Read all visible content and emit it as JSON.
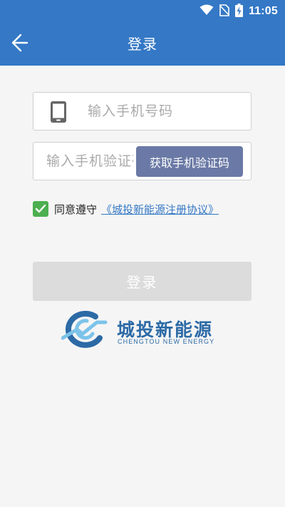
{
  "status_bar": {
    "time": "11:05",
    "icons": [
      "wifi-icon",
      "no-sim-icon",
      "battery-charging-icon"
    ]
  },
  "header": {
    "title": "登录",
    "back_icon": "back-arrow-icon"
  },
  "form": {
    "phone": {
      "icon": "mobile-phone-icon",
      "placeholder": "输入手机号码",
      "value": ""
    },
    "code": {
      "placeholder": "输入手机验证码",
      "value": "",
      "button_label": "获取手机验证码"
    },
    "agreement": {
      "checked": true,
      "text": "同意遵守",
      "link_text": "《城投新能源注册协议》"
    },
    "login_button_label": "登录"
  },
  "logo": {
    "name_cn": "城投新能源",
    "name_en": "CHENGTOU NEW ENERGY"
  },
  "colors": {
    "primary": "#3478c6",
    "sms_button": "#6a79a5",
    "checkbox": "#4caf50",
    "login_disabled": "#dcdcdc",
    "logo": "#2c6aa6"
  }
}
